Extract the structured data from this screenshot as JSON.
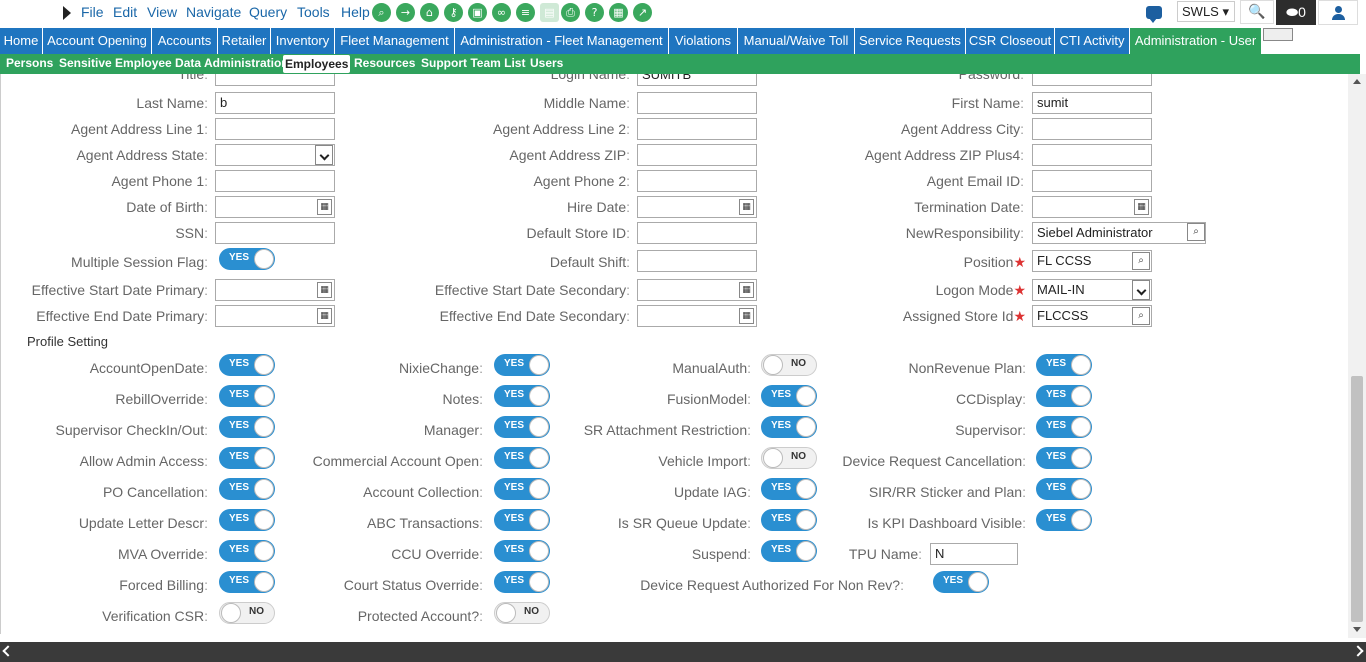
{
  "menubar": {
    "menus": [
      "File",
      "Edit",
      "View",
      "Navigate",
      "Query",
      "Tools",
      "Help"
    ],
    "toolbar_icons": [
      "query-icon",
      "go-icon",
      "home-icon",
      "key-icon",
      "delete-icon",
      "link-icon",
      "list-icon",
      "doc-icon",
      "print-icon",
      "help-icon",
      "report-icon",
      "chart-icon"
    ],
    "site": "SWLS ▾",
    "notification_count": "0",
    "search_glyph": "🔍"
  },
  "nav": {
    "tabs": [
      "Home",
      "Account Opening",
      "Accounts",
      "Retailer",
      "Inventory",
      "Fleet Management",
      "Administration - Fleet Management",
      "Violations",
      "Manual/Waive Toll",
      "Service Requests",
      "CSR Closeout",
      "CTI Activity",
      "Administration - User"
    ],
    "active_tab": "Administration - User"
  },
  "subnav": {
    "tabs": [
      "Persons",
      "Sensitive Employee Data Administration",
      "Employees",
      "Resources",
      "Support Team List",
      "Users"
    ],
    "active_tab": "Employees"
  },
  "form": {
    "partial_top": {
      "title_label": "Title",
      "login_label": "Login Name",
      "login_value": "SUMITB",
      "password_label": "Password"
    },
    "fields": {
      "last_name": {
        "label": "Last Name",
        "value": "b"
      },
      "middle_name": {
        "label": "Middle Name",
        "value": ""
      },
      "first_name": {
        "label": "First Name",
        "value": "sumit"
      },
      "addr1": {
        "label": "Agent Address Line 1",
        "value": ""
      },
      "addr2": {
        "label": "Agent Address Line 2",
        "value": ""
      },
      "city": {
        "label": "Agent Address City",
        "value": ""
      },
      "state": {
        "label": "Agent Address State",
        "value": ""
      },
      "zip": {
        "label": "Agent Address ZIP",
        "value": ""
      },
      "zip4": {
        "label": "Agent Address ZIP Plus4",
        "value": ""
      },
      "phone1": {
        "label": "Agent Phone 1",
        "value": ""
      },
      "phone2": {
        "label": "Agent Phone 2",
        "value": ""
      },
      "email": {
        "label": "Agent Email ID",
        "value": ""
      },
      "dob": {
        "label": "Date of Birth",
        "value": ""
      },
      "hire": {
        "label": "Hire Date",
        "value": ""
      },
      "term": {
        "label": "Termination Date",
        "value": ""
      },
      "ssn": {
        "label": "SSN",
        "value": ""
      },
      "store": {
        "label": "Default Store ID",
        "value": ""
      },
      "newresp": {
        "label": "NewResponsibility",
        "value": "Siebel Administrator"
      },
      "msf": {
        "label": "Multiple Session Flag",
        "value": "YES"
      },
      "shift": {
        "label": "Default Shift",
        "value": ""
      },
      "position": {
        "label": "Position",
        "value": "FL CCSS"
      },
      "esdp": {
        "label": "Effective Start Date Primary",
        "value": ""
      },
      "esds": {
        "label": "Effective Start Date Secondary",
        "value": ""
      },
      "logon": {
        "label": "Logon Mode",
        "value": "MAIL-IN"
      },
      "eedp": {
        "label": "Effective End Date Primary",
        "value": ""
      },
      "eeds": {
        "label": "Effective End Date Secondary",
        "value": ""
      },
      "assigned": {
        "label": "Assigned Store Id",
        "value": "FLCCSS"
      }
    },
    "profile_section_title": "Profile Setting",
    "profile": [
      {
        "label": "AccountOpenDate",
        "value": "YES"
      },
      {
        "label": "NixieChange",
        "value": "YES"
      },
      {
        "label": "ManualAuth",
        "value": "NO"
      },
      {
        "label": "NonRevenue Plan",
        "value": "YES"
      },
      {
        "label": "RebillOverride",
        "value": "YES"
      },
      {
        "label": "Notes",
        "value": "YES"
      },
      {
        "label": "FusionModel",
        "value": "YES"
      },
      {
        "label": "CCDisplay",
        "value": "YES"
      },
      {
        "label": "Supervisor CheckIn/Out",
        "value": "YES"
      },
      {
        "label": "Manager",
        "value": "YES"
      },
      {
        "label": "SR Attachment Restriction",
        "value": "YES"
      },
      {
        "label": "Supervisor",
        "value": "YES"
      },
      {
        "label": "Allow Admin Access",
        "value": "YES"
      },
      {
        "label": "Commercial Account Open",
        "value": "YES"
      },
      {
        "label": "Vehicle Import",
        "value": "NO"
      },
      {
        "label": "Device Request Cancellation",
        "value": "YES"
      },
      {
        "label": "PO Cancellation",
        "value": "YES"
      },
      {
        "label": "Account Collection",
        "value": "YES"
      },
      {
        "label": "Update IAG",
        "value": "YES"
      },
      {
        "label": "SIR/RR Sticker and Plan",
        "value": "YES"
      },
      {
        "label": "Update Letter Descr",
        "value": "YES"
      },
      {
        "label": "ABC Transactions",
        "value": "YES"
      },
      {
        "label": "Is SR Queue Update",
        "value": "YES"
      },
      {
        "label": "Is KPI Dashboard Visible",
        "value": "YES"
      },
      {
        "label": "MVA Override",
        "value": "YES"
      },
      {
        "label": "CCU Override",
        "value": "YES"
      },
      {
        "label": "Suspend",
        "value": "YES"
      },
      {
        "label": "TPU Name",
        "value": "N"
      },
      {
        "label": "Forced Billing",
        "value": "YES"
      },
      {
        "label": "Court Status Override",
        "value": "YES"
      },
      {
        "label": "Device Request Authorized For Non Rev?",
        "value": "YES"
      },
      {
        "label": "Verification CSR",
        "value": "NO"
      },
      {
        "label": "Protected Account?",
        "value": "NO"
      }
    ]
  },
  "colors": {
    "nav_blue": "#1f75c0",
    "nav_green": "#2fa25d",
    "toggle_on": "#2a8fd1",
    "required": "#dd3333"
  }
}
